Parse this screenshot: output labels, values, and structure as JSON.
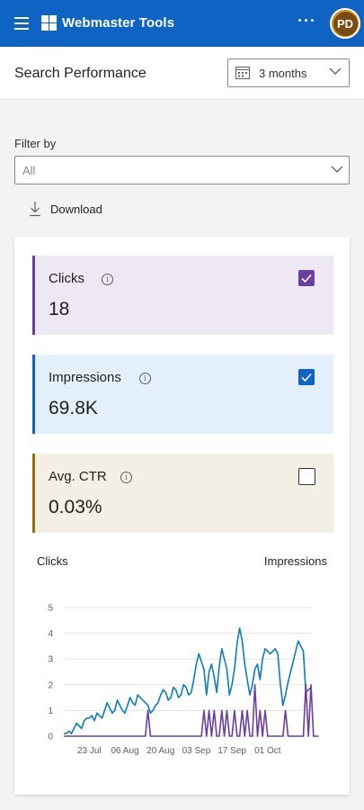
{
  "topbar": {
    "app_title": "Webmaster Tools",
    "more_label": "···",
    "avatar_initials": "PD",
    "bg_color": "#0f63c3"
  },
  "header": {
    "page_title": "Search Performance",
    "range_value": "3 months"
  },
  "filter": {
    "label": "Filter by",
    "value": "All"
  },
  "download_label": "Download",
  "metrics": [
    {
      "label": "Clicks",
      "value": "18",
      "checked": true,
      "accent": "#6b3fa0",
      "bg": "#eee8f5"
    },
    {
      "label": "Impressions",
      "value": "69.8K",
      "checked": true,
      "accent": "#0f63c3",
      "bg": "#e3f0fb"
    },
    {
      "label": "Avg. CTR",
      "value": "0.03%",
      "checked": false,
      "accent": "#986f0b",
      "bg": "#f3efe4"
    }
  ],
  "chart_data": {
    "type": "line",
    "left_axis_title": "Clicks",
    "right_axis_title": "Impressions",
    "ylim": [
      0,
      5
    ],
    "yticks": [
      "0",
      "1",
      "2",
      "3",
      "4",
      "5"
    ],
    "x_tick_labels": [
      "23 Jul",
      "06 Aug",
      "20 Aug",
      "03 Sep",
      "17 Sep",
      "01 Oct"
    ],
    "x_tick_days": [
      10,
      24,
      38,
      52,
      66,
      80
    ],
    "grid": true,
    "series": [
      {
        "name": "Impressions",
        "color": "#0b7db8",
        "values": [
          0.1,
          0.1,
          0.2,
          0.1,
          0.3,
          0.5,
          0.4,
          0.3,
          0.6,
          0.7,
          0.7,
          0.8,
          0.6,
          0.9,
          0.8,
          0.7,
          1.0,
          1.3,
          1.1,
          0.9,
          1.0,
          1.4,
          1.2,
          1.0,
          0.9,
          1.2,
          1.5,
          1.3,
          1.2,
          1.6,
          1.5,
          1.4,
          1.3,
          1.2,
          0.9,
          1.0,
          1.2,
          1.3,
          1.6,
          1.8,
          1.7,
          1.4,
          1.5,
          1.9,
          1.8,
          1.5,
          1.6,
          2.0,
          1.9,
          1.6,
          1.7,
          2.2,
          2.8,
          3.2,
          2.9,
          2.6,
          1.6,
          2.5,
          2.8,
          2.3,
          1.7,
          2.7,
          3.4,
          3.0,
          2.6,
          1.6,
          2.0,
          2.6,
          3.6,
          4.2,
          3.7,
          2.8,
          2.2,
          1.6,
          2.0,
          2.6,
          2.8,
          2.2,
          3.0,
          3.4,
          3.3,
          3.2,
          3.3,
          3.4,
          3.2,
          2.0,
          1.2,
          1.6,
          2.1,
          2.5,
          2.9,
          3.3,
          3.7,
          3.5,
          3.3,
          1.7,
          1.8,
          1.9
        ]
      },
      {
        "name": "Clicks",
        "color": "#6b3fa0",
        "values": [
          0,
          0,
          0,
          0,
          0,
          0,
          0,
          0,
          0,
          0,
          0,
          0,
          0,
          0,
          0,
          0,
          0,
          0,
          0,
          0,
          0,
          0,
          0,
          0,
          0,
          0,
          0,
          0,
          0,
          0,
          0,
          0,
          0,
          1,
          0,
          0,
          0,
          0,
          0,
          0,
          0,
          0,
          0,
          0,
          0,
          0,
          0,
          0,
          0,
          0,
          0,
          0,
          0,
          0,
          0,
          1,
          0,
          1,
          0,
          1,
          0,
          0,
          1,
          0,
          1,
          0,
          0,
          1,
          0,
          0,
          1,
          0,
          1,
          0,
          0,
          2,
          0,
          1,
          0,
          1,
          0,
          0,
          0,
          0,
          0,
          0,
          0,
          1,
          0,
          0,
          0,
          0,
          0,
          0,
          0,
          2,
          0,
          2,
          0,
          0,
          0
        ]
      }
    ]
  }
}
